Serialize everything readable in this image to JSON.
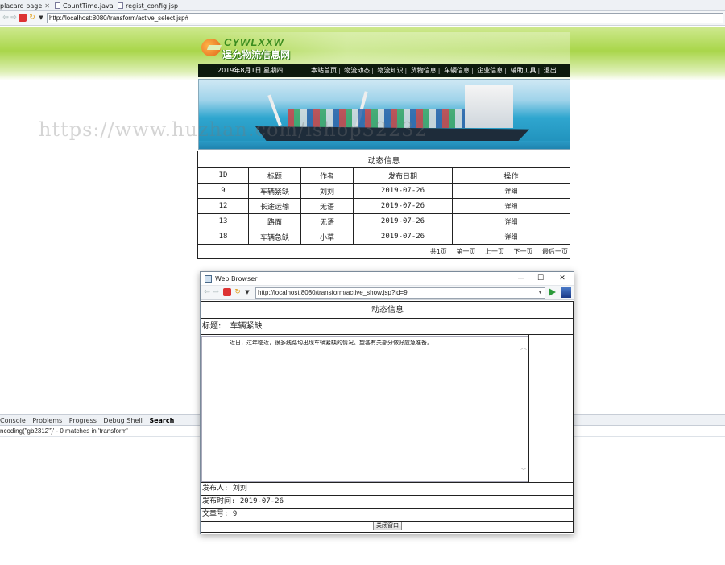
{
  "ide": {
    "tabs": [
      {
        "label": "placard page"
      },
      {
        "label": "CountTime.java"
      },
      {
        "label": "regist_config.jsp"
      }
    ],
    "url": "http://localhost:8080/transform/active_select.jsp#",
    "panel_tabs": [
      {
        "label": "Console"
      },
      {
        "label": "Problems"
      },
      {
        "label": "Progress"
      },
      {
        "label": "Debug Shell"
      },
      {
        "label": "Search"
      }
    ],
    "console_text": "ncoding(\"gb2312\")' - 0 matches in 'transform'"
  },
  "site": {
    "logo_en": "CYWLXXW",
    "logo_cn": "逞允物流信息网",
    "date_text": "2019年8月1日 星期四",
    "nav": [
      "本站首页",
      "物流动态",
      "物流知识",
      "货物信息",
      "车辆信息",
      "企业信息",
      "辅助工具",
      "退出"
    ],
    "watermark": "https://www.huzhan.com/ishop32232"
  },
  "table": {
    "caption": "动态信息",
    "headers": [
      "ID",
      "标题",
      "作者",
      "发布日期",
      "操作"
    ],
    "rows": [
      {
        "id": "9",
        "title": "车辆紧缺",
        "author": "刘刘",
        "date": "2019-07-26",
        "action": "详细"
      },
      {
        "id": "12",
        "title": "长途运输",
        "author": "无语",
        "date": "2019-07-26",
        "action": "详细"
      },
      {
        "id": "13",
        "title": "路面",
        "author": "无语",
        "date": "2019-07-26",
        "action": "详细"
      },
      {
        "id": "18",
        "title": "车辆急缺",
        "author": "小草",
        "date": "2019-07-26",
        "action": "详细"
      }
    ],
    "pager": {
      "total": "共1页",
      "first": "第一页",
      "prev": "上一页",
      "next": "下一页",
      "last": "最后一页"
    }
  },
  "popup": {
    "window_title": "Web Browser",
    "url": "http://localhost:8080/transform/active_show.jsp?id=9",
    "heading": "动态信息",
    "title_label": "标题:",
    "title_value": "车辆紧缺",
    "body": "近日，过年临近，很多线路均出现车辆紧缺的情况。望各有关部分做好应急准备。",
    "publisher": "发布人: 刘刘",
    "publish_time": "发布时间: 2019-07-26",
    "article_no": "文章号: 9",
    "close_button": "关闭窗口"
  },
  "colors": {
    "site_green": "#a9d64a",
    "nav_bg": "#0d1a0d",
    "sea_blue": "#2fa6cf"
  }
}
